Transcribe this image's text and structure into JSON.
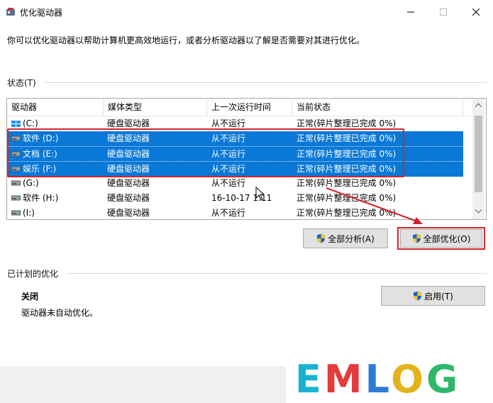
{
  "window": {
    "title": "优化驱动器"
  },
  "description": "你可以优化驱动器以帮助计算机更高效地运行，或者分析驱动器以了解是否需要对其进行优化。",
  "status": {
    "label": "状态(T)",
    "columns": [
      "驱动器",
      "媒体类型",
      "上一次运行时间",
      "当前状态"
    ],
    "rows": [
      {
        "drive": "(C:)",
        "media": "硬盘驱动器",
        "last_run": "从不运行",
        "state": "正常(碎片整理已完成 0%)",
        "selected": false,
        "icon": "windows-drive-icon"
      },
      {
        "drive": "软件 (D:)",
        "media": "硬盘驱动器",
        "last_run": "从不运行",
        "state": "正常(碎片整理已完成 0%)",
        "selected": true,
        "icon": "drive-icon"
      },
      {
        "drive": "文档 (E:)",
        "media": "硬盘驱动器",
        "last_run": "从不运行",
        "state": "正常(碎片整理已完成 0%)",
        "selected": true,
        "icon": "drive-icon"
      },
      {
        "drive": "娱乐 (F:)",
        "media": "硬盘驱动器",
        "last_run": "从不运行",
        "state": "正常(碎片整理已完成 0%)",
        "selected": true,
        "icon": "drive-icon"
      },
      {
        "drive": "(G:)",
        "media": "硬盘驱动器",
        "last_run": "从不运行",
        "state": "正常(碎片整理已完成 0%)",
        "selected": false,
        "icon": "drive-icon"
      },
      {
        "drive": "软件 (H:)",
        "media": "硬盘驱动器",
        "last_run": "16-10-17 1:11",
        "state": "正常(碎片整理已完成 0%)",
        "selected": false,
        "icon": "drive-icon"
      },
      {
        "drive": "(I:)",
        "media": "硬盘驱动器",
        "last_run": "从不运行",
        "state": "正常(碎片整理已完成 0%)",
        "selected": false,
        "icon": "drive-icon"
      }
    ]
  },
  "buttons": {
    "analyze_all": "全部分析(A)",
    "optimize_all": "全部优化(O)",
    "enable": "启用(T)"
  },
  "scheduled": {
    "label": "已计划的优化",
    "state": "关闭",
    "desc": "驱动器未自动优化。"
  },
  "watermark": "EMLOG",
  "colors": {
    "selection": "#0a78d7",
    "highlight": "#d4242a",
    "accent_arrow": "#d4242a"
  }
}
